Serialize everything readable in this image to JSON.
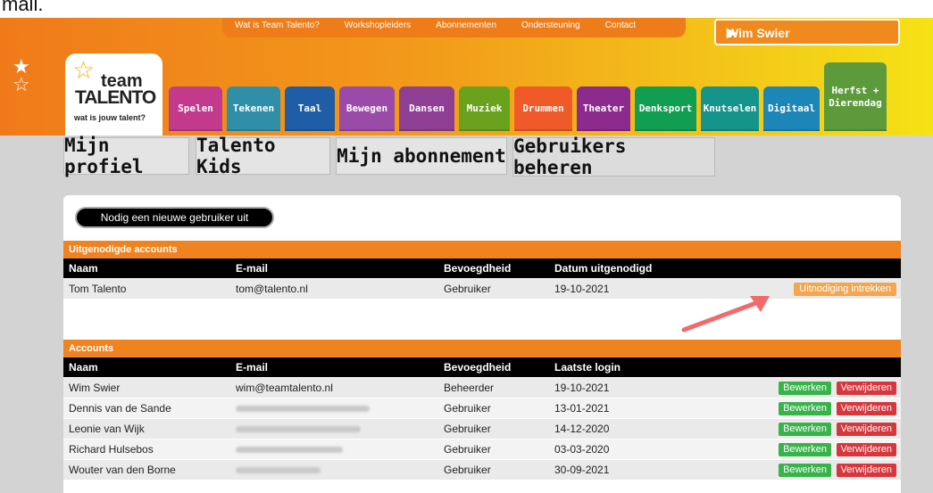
{
  "fragment": "mail.",
  "topnav": [
    "Wat is Team Talento?",
    "Workshopleiders",
    "Abonnementen",
    "Ondersteuning",
    "Contact"
  ],
  "user": {
    "name": "Wim Swier",
    "arrow": "▶"
  },
  "logo": {
    "line1": "team",
    "line2": "TALENTO",
    "tagline": "wat is jouw talent?"
  },
  "categories": [
    {
      "label": "Spelen",
      "color": "#c33a8d"
    },
    {
      "label": "Tekenen",
      "color": "#2f8fa8"
    },
    {
      "label": "Taal",
      "color": "#1f5ea7"
    },
    {
      "label": "Bewegen",
      "color": "#9a4aa8"
    },
    {
      "label": "Dansen",
      "color": "#8e3f94"
    },
    {
      "label": "Muziek",
      "color": "#6aa21e"
    },
    {
      "label": "Drummen",
      "color": "#f05a28"
    },
    {
      "label": "Theater",
      "color": "#8c2b8d"
    },
    {
      "label": "Denksport",
      "color": "#129e52"
    },
    {
      "label": "Knutselen",
      "color": "#14948a"
    },
    {
      "label": "Digitaal",
      "color": "#1d86b8"
    },
    {
      "label": "Herfst + Dierendag",
      "color": "#5c9a3c"
    }
  ],
  "tabs": [
    "Mijn profiel",
    "Talento Kids",
    "Mijn abonnement",
    "Gebruikers beheren"
  ],
  "invite_button": "Nodig een nieuwe gebruiker uit",
  "invited": {
    "title": "Uitgenodigde accounts",
    "headers": [
      "Naam",
      "E-mail",
      "Bevoegdheid",
      "Datum uitgenodigd"
    ],
    "rows": [
      {
        "name": "Tom Talento",
        "email": "tom@talento.nl",
        "role": "Gebruiker",
        "date": "19-10-2021",
        "action": "Uitnodiging intrekken"
      }
    ]
  },
  "accounts": {
    "title": "Accounts",
    "headers": [
      "Naam",
      "E-mail",
      "Bevoegdheid",
      "Laatste login"
    ],
    "edit_label": "Bewerken",
    "delete_label": "Verwijderen",
    "rows": [
      {
        "name": "Wim Swier",
        "email": "wim@teamtalento.nl",
        "role": "Beheerder",
        "date": "19-10-2021"
      },
      {
        "name": "Dennis van de Sande",
        "email": "",
        "role": "Gebruiker",
        "date": "13-01-2021"
      },
      {
        "name": "Leonie van Wijk",
        "email": "",
        "role": "Gebruiker",
        "date": "14-12-2020"
      },
      {
        "name": "Richard Hulsebos",
        "email": "",
        "role": "Gebruiker",
        "date": "03-03-2020"
      },
      {
        "name": "Wouter van den Borne",
        "email": "",
        "role": "Gebruiker",
        "date": "30-09-2021"
      }
    ]
  }
}
